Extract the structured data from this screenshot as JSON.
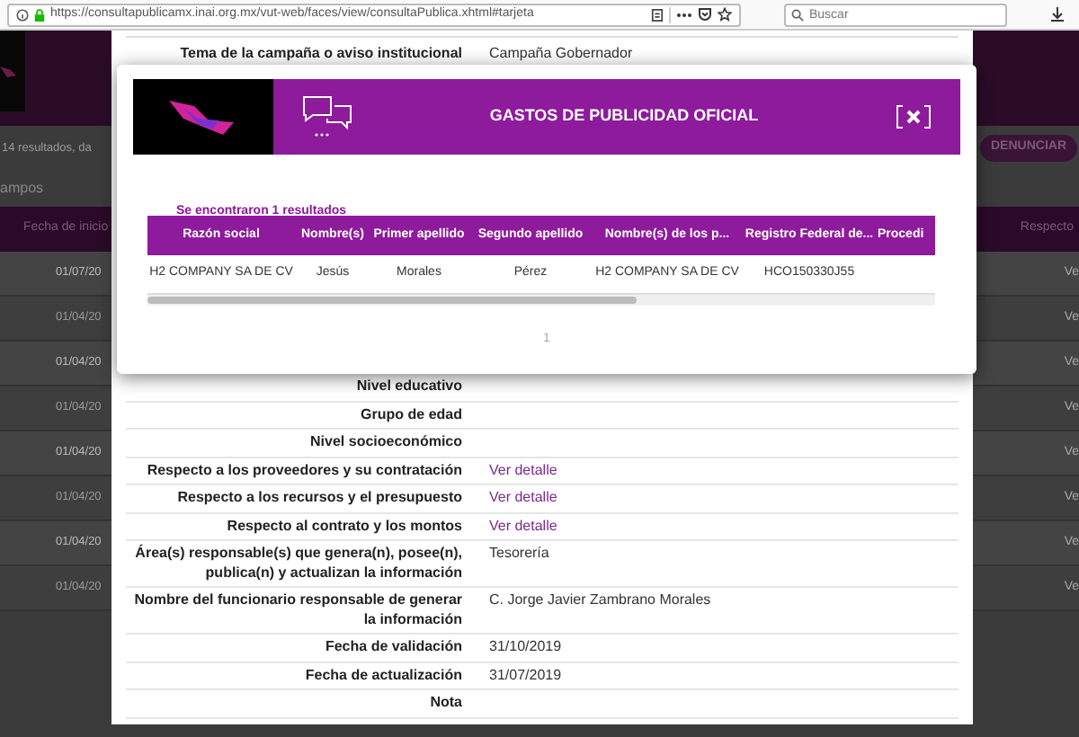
{
  "browser": {
    "url": "https://consultapublicamx.inai.org.mx/vut-web/faces/view/consultaPublica.xhtml#tarjeta",
    "search_placeholder": "Buscar"
  },
  "background_page": {
    "results_text": "14 resultados, da",
    "denounce_button": "DENUNCIAR",
    "fields_link": "ampos",
    "columns": [
      "Fecha de inicio",
      "Respecto"
    ],
    "rows": [
      {
        "date": "01/07/20",
        "link": "Ve"
      },
      {
        "date": "01/04/20",
        "link": "Ve"
      },
      {
        "date": "01/04/20",
        "link": "Ve"
      },
      {
        "date": "01/04/20",
        "link": "Ve"
      },
      {
        "date": "01/04/20",
        "link": "Ve"
      },
      {
        "date": "01/04/20",
        "link": "Ve"
      },
      {
        "date": "01/04/20",
        "link": "Ve"
      },
      {
        "date": "01/04/20",
        "link": "Ve"
      }
    ]
  },
  "detail": {
    "top_row": {
      "label": "Tema de la campaña o aviso institucional",
      "value": "Campaña Gobernador"
    },
    "rows": [
      {
        "label": "Nivel educativo"
      },
      {
        "label": "Grupo de edad"
      },
      {
        "label": "Nivel socioeconómico"
      },
      {
        "label": "Respecto a los proveedores y su contratación",
        "link": "Ver detalle"
      },
      {
        "label": "Respecto a los recursos y el presupuesto",
        "link": "Ver detalle"
      },
      {
        "label": "Respecto al contrato y los montos",
        "link": "Ver detalle"
      },
      {
        "label": "Área(s) responsable(s) que genera(n), posee(n), publica(n) y actualizan la información",
        "value": "Tesorería"
      },
      {
        "label": "Nombre del funcionario responsable de generar la información",
        "value": "C. Jorge Javier Zambrano Morales"
      },
      {
        "label": "Fecha de validación",
        "value": "31/10/2019"
      },
      {
        "label": "Fecha de actualización",
        "value": "31/07/2019"
      },
      {
        "label": "Nota"
      }
    ]
  },
  "modal": {
    "title": "GASTOS DE PUBLICIDAD OFICIAL",
    "results_text": "Se encontraron 1 resultados",
    "table": {
      "columns": [
        "Razón social",
        "Nombre(s)",
        "Primer apellido",
        "Segundo apellido",
        "Nombre(s) de los p...",
        "Registro Federal de...",
        "Procedi"
      ],
      "rows": [
        [
          "H2 COMPANY SA DE CV",
          "Jesús",
          "Morales",
          "Pérez",
          "H2 COMPANY SA DE CV",
          "HCO150330J55",
          ""
        ]
      ]
    },
    "pagination": [
      {
        "label": "1",
        "selected": true
      }
    ]
  }
}
